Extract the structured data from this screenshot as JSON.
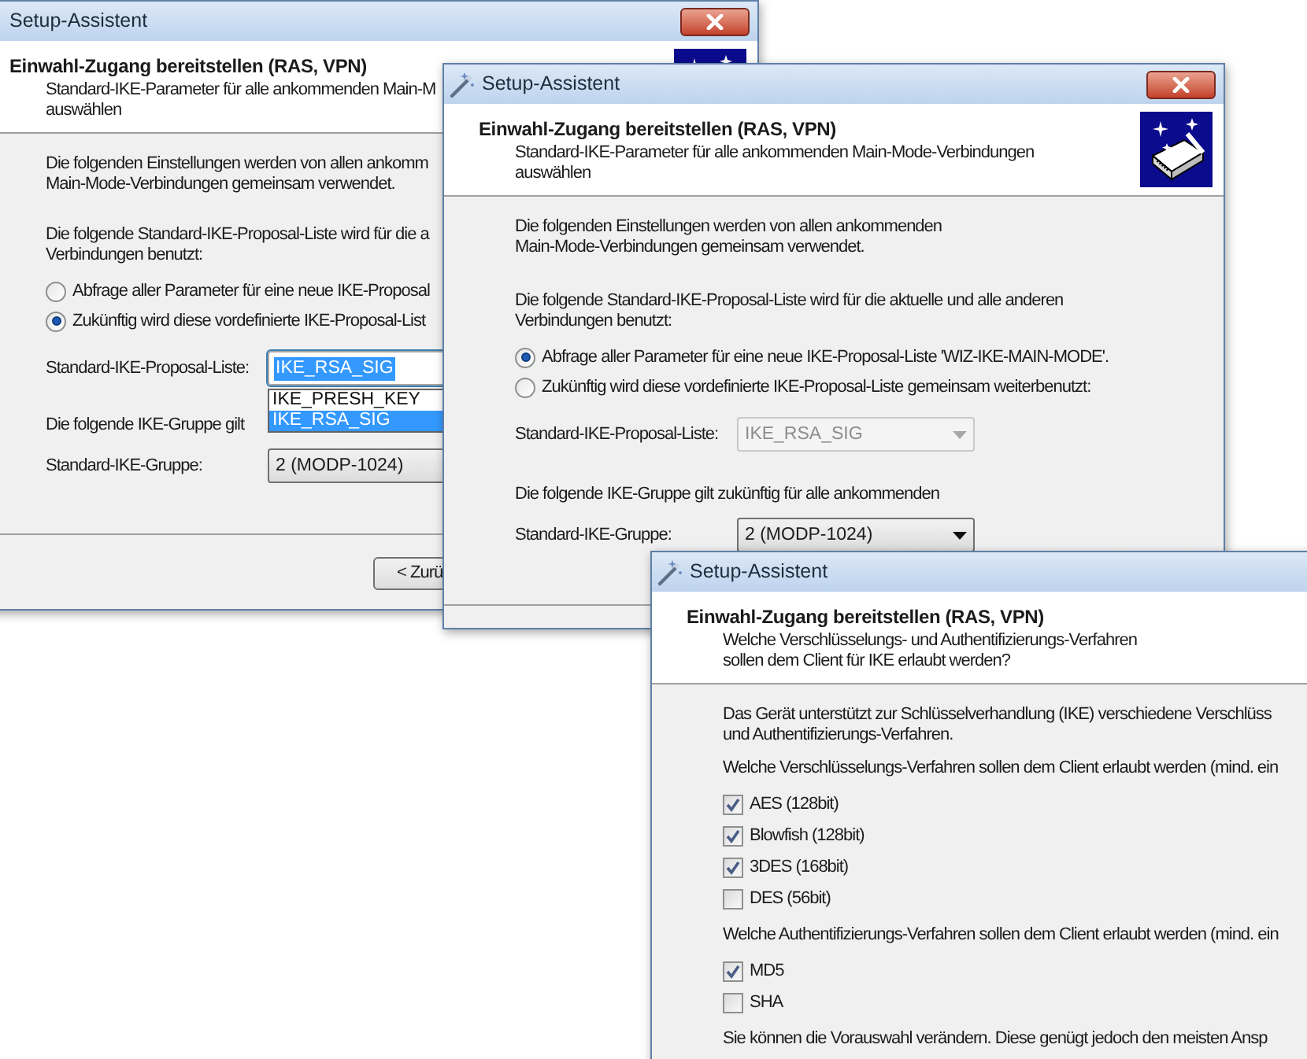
{
  "windows": [
    {
      "title": "Setup-Assistent",
      "wand_icon": false,
      "close_button": true,
      "header_icon": true,
      "heading": "Einwahl-Zugang bereitstellen (RAS, VPN)",
      "subheading": [
        "Standard-IKE-Parameter für alle ankommenden Main-M",
        "auswählen"
      ],
      "content": [
        {
          "kind": "text",
          "lines": [
            "Die folgenden Einstellungen werden von allen ankomm",
            "Main-Mode-Verbindungen gemeinsam verwendet."
          ]
        },
        {
          "kind": "text",
          "lines": [
            "Die folgende Standard-IKE-Proposal-Liste wird für die a",
            "Verbindungen benutzt:"
          ]
        },
        {
          "kind": "radio",
          "label": "Abfrage aller Parameter für eine neue IKE-Proposal",
          "checked": false
        },
        {
          "kind": "radio",
          "label": "Zukünftig wird diese vordefinierte IKE-Proposal-List",
          "checked": true
        },
        {
          "kind": "combo",
          "label": "Standard-IKE-Proposal-Liste:",
          "value": "IKE_RSA_SIG",
          "editable": true,
          "value_highlighted": true,
          "disabled": false,
          "open": true,
          "options": [
            {
              "label": "IKE_PRESH_KEY",
              "selected": false
            },
            {
              "label": "IKE_RSA_SIG",
              "selected": true
            }
          ]
        },
        {
          "kind": "text",
          "lines": [
            "Die folgende IKE-Gruppe gilt"
          ]
        },
        {
          "kind": "combo",
          "label": "Standard-IKE-Gruppe:",
          "value": "2 (MODP-1024)",
          "disabled": false,
          "open": false
        }
      ],
      "footer_buttons": [
        "< Zurü"
      ]
    },
    {
      "title": "Setup-Assistent",
      "wand_icon": true,
      "close_button": true,
      "header_icon": true,
      "heading": "Einwahl-Zugang bereitstellen (RAS, VPN)",
      "subheading": [
        "Standard-IKE-Parameter für alle ankommenden Main-Mode-Verbindungen",
        "auswählen"
      ],
      "content": [
        {
          "kind": "text",
          "lines": [
            "Die folgenden Einstellungen werden von allen ankommenden",
            "Main-Mode-Verbindungen gemeinsam verwendet."
          ]
        },
        {
          "kind": "text",
          "lines": [
            "Die folgende Standard-IKE-Proposal-Liste wird für die aktuelle und alle anderen",
            "Verbindungen benutzt:"
          ]
        },
        {
          "kind": "radio",
          "label": "Abfrage aller Parameter für eine neue IKE-Proposal-Liste 'WIZ-IKE-MAIN-MODE'.",
          "checked": true
        },
        {
          "kind": "radio",
          "label": "Zukünftig wird diese vordefinierte IKE-Proposal-Liste gemeinsam weiterbenutzt:",
          "checked": false
        },
        {
          "kind": "combo",
          "label": "Standard-IKE-Proposal-Liste:",
          "value": "IKE_RSA_SIG",
          "disabled": true,
          "open": false
        },
        {
          "kind": "text",
          "lines": [
            "Die folgende IKE-Gruppe gilt zukünftig für alle ankommenden"
          ]
        },
        {
          "kind": "combo",
          "label": "Standard-IKE-Gruppe:",
          "value": "2 (MODP-1024)",
          "disabled": false,
          "open": false
        }
      ]
    },
    {
      "title": "Setup-Assistent",
      "wand_icon": true,
      "close_button": false,
      "header_icon": false,
      "heading": "Einwahl-Zugang bereitstellen (RAS, VPN)",
      "subheading": [
        "Welche Verschlüsselungs- und Authentifizierungs-Verfahren",
        "sollen dem Client für IKE erlaubt werden?"
      ],
      "content": [
        {
          "kind": "text",
          "lines": [
            "Das Gerät unterstützt zur Schlüsselverhandlung (IKE) verschiedene Verschlüss",
            "und Authentifizierungs-Verfahren."
          ]
        },
        {
          "kind": "text",
          "lines": [
            "Welche Verschlüsselungs-Verfahren sollen dem Client erlaubt werden (mind. ein"
          ]
        },
        {
          "kind": "checkbox",
          "label": "AES (128bit)",
          "checked": true
        },
        {
          "kind": "checkbox",
          "label": "Blowfish (128bit)",
          "checked": true
        },
        {
          "kind": "checkbox",
          "label": "3DES (168bit)",
          "checked": true
        },
        {
          "kind": "checkbox",
          "label": "DES (56bit)",
          "checked": false
        },
        {
          "kind": "text",
          "lines": [
            "Welche Authentifizierungs-Verfahren sollen dem Client erlaubt werden (mind. ein"
          ]
        },
        {
          "kind": "checkbox",
          "label": "MD5",
          "checked": true
        },
        {
          "kind": "checkbox",
          "label": "SHA",
          "checked": false
        },
        {
          "kind": "text",
          "lines": [
            "Sie können die Vorauswahl verändern. Diese genügt jedoch den meisten Ansp"
          ]
        }
      ]
    }
  ]
}
